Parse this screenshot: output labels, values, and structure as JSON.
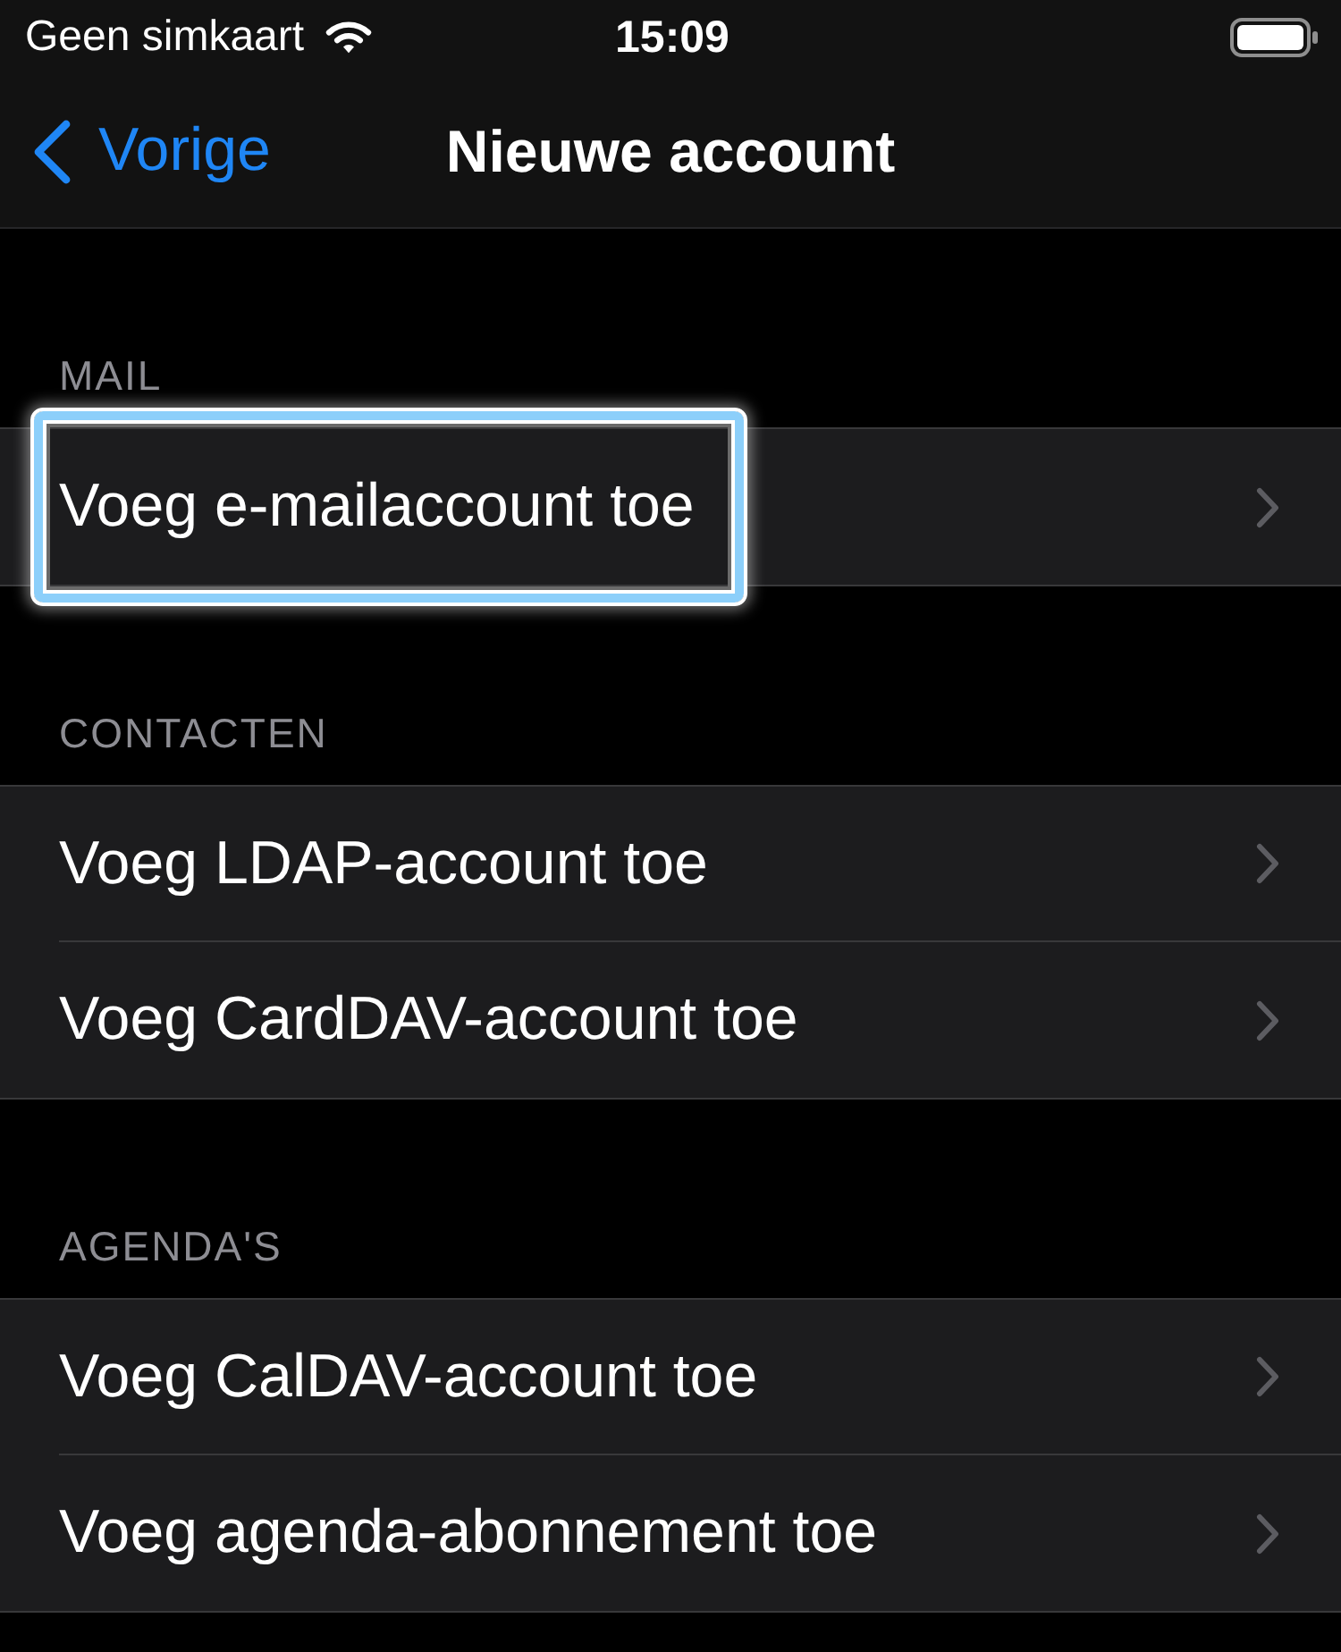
{
  "status_bar": {
    "carrier": "Geen simkaart",
    "time": "15:09"
  },
  "nav_bar": {
    "back_label": "Vorige",
    "title": "Nieuwe account"
  },
  "sections": [
    {
      "header": "MAIL",
      "rows": [
        {
          "label": "Voeg e-mailaccount toe",
          "highlighted": true
        }
      ]
    },
    {
      "header": "CONTACTEN",
      "rows": [
        {
          "label": "Voeg LDAP-account toe",
          "highlighted": false
        },
        {
          "label": "Voeg CardDAV-account toe",
          "highlighted": false
        }
      ]
    },
    {
      "header": "AGENDA'S",
      "rows": [
        {
          "label": "Voeg CalDAV-account toe",
          "highlighted": false
        },
        {
          "label": "Voeg agenda-abonnement toe",
          "highlighted": false
        }
      ]
    }
  ]
}
